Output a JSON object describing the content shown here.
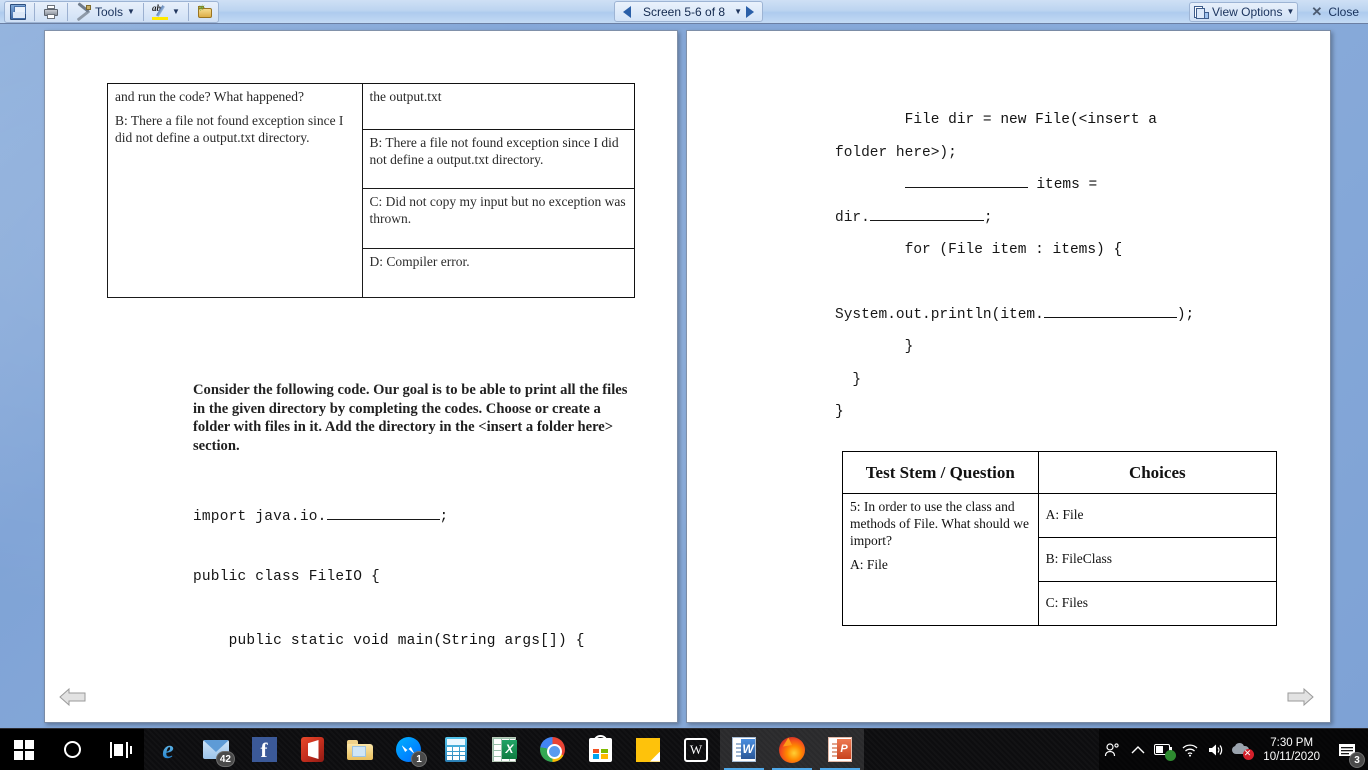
{
  "toolbar": {
    "save_label": "Save",
    "print_label": "Print",
    "tools_label": "Tools",
    "highlight_label": "Highlight",
    "newfolder_label": "New Folder",
    "screen_nav_label": "Screen 5-6 of 8",
    "prev_label": "Previous",
    "next_label": "Next",
    "view_options_label": "View Options",
    "close_label": "Close",
    "close_glyph": "✕"
  },
  "document": {
    "left_page": {
      "table": {
        "rows": [
          {
            "left": [
              "and run the code? What happened?",
              "B: There a file not found exception since I did not define a output.txt directory."
            ],
            "right": "the output.txt"
          },
          {
            "right": "B: There a file not found exception since I did not define a output.txt directory."
          },
          {
            "right": "C: Did not copy my input but no exception was thrown."
          },
          {
            "right": "D: Compiler error."
          }
        ]
      },
      "instructions": "Consider the following code. Our goal is to be able to print all the files in the given directory by completing the codes. Choose or create a folder with files in it. Add the directory in the <insert a folder here> section.",
      "code": {
        "import_prefix": "import java.io.",
        "import_suffix": ";",
        "class_line": "public class FileIO {",
        "main_line": "    public static void main(String args[]) {"
      }
    },
    "right_page": {
      "code_lines": [
        {
          "text": "        File dir = new File(<insert a"
        },
        {
          "text": "folder here>);"
        },
        {
          "pre": "        ",
          "blank": true,
          "post": " items ="
        },
        {
          "pre": "dir.",
          "blank": true,
          "post": ";"
        },
        {
          "text": "        for (File item : items) {"
        },
        {
          "text": ""
        },
        {
          "pre": "System.out.println(item.",
          "blank": true,
          "post": ");"
        },
        {
          "text": "        }"
        },
        {
          "text": "  }"
        },
        {
          "text": "}"
        }
      ],
      "table": {
        "headers": [
          "Test Stem / Question",
          "Choices"
        ],
        "question_lines": [
          "5: In order to use the class and methods of File. What should we import?",
          "A: File"
        ],
        "choices": [
          "A: File",
          "B: FileClass",
          "C: Files"
        ]
      }
    }
  },
  "taskbar": {
    "start_label": "Start",
    "search_label": "Search",
    "taskview_label": "Task View",
    "apps": [
      {
        "name": "internet-explorer",
        "label": "Internet Explorer",
        "badge": "",
        "active": false
      },
      {
        "name": "mail",
        "label": "Mail",
        "badge": "42",
        "active": false
      },
      {
        "name": "facebook",
        "label": "Facebook",
        "badge": "",
        "active": false
      },
      {
        "name": "office",
        "label": "Office",
        "badge": "",
        "active": false
      },
      {
        "name": "file-explorer",
        "label": "File Explorer",
        "badge": "",
        "active": false
      },
      {
        "name": "messenger",
        "label": "Messenger",
        "badge": "1",
        "active": false
      },
      {
        "name": "calculator",
        "label": "Calculator",
        "badge": "",
        "active": false
      },
      {
        "name": "excel",
        "label": "Excel",
        "badge": "",
        "active": false
      },
      {
        "name": "chrome",
        "label": "Chrome",
        "badge": "",
        "active": false
      },
      {
        "name": "microsoft-store",
        "label": "Microsoft Store",
        "badge": "",
        "active": false
      },
      {
        "name": "sticky-notes",
        "label": "Sticky Notes",
        "badge": "",
        "active": false
      },
      {
        "name": "wattpad",
        "label": "Wattpad",
        "badge": "",
        "active": false
      },
      {
        "name": "word",
        "label": "Word",
        "badge": "",
        "active": true
      },
      {
        "name": "firefox",
        "label": "Firefox",
        "badge": "",
        "active": true
      },
      {
        "name": "powerpoint",
        "label": "PowerPoint",
        "badge": "",
        "active": true
      }
    ],
    "tray": {
      "people_label": "People",
      "show_hidden_label": "Show hidden icons",
      "battery_label": "Battery",
      "wifi_label": "Network",
      "volume_label": "Volume",
      "onedrive_label": "OneDrive",
      "time": "7:30 PM",
      "date": "10/11/2020",
      "notification_count": "3"
    }
  }
}
